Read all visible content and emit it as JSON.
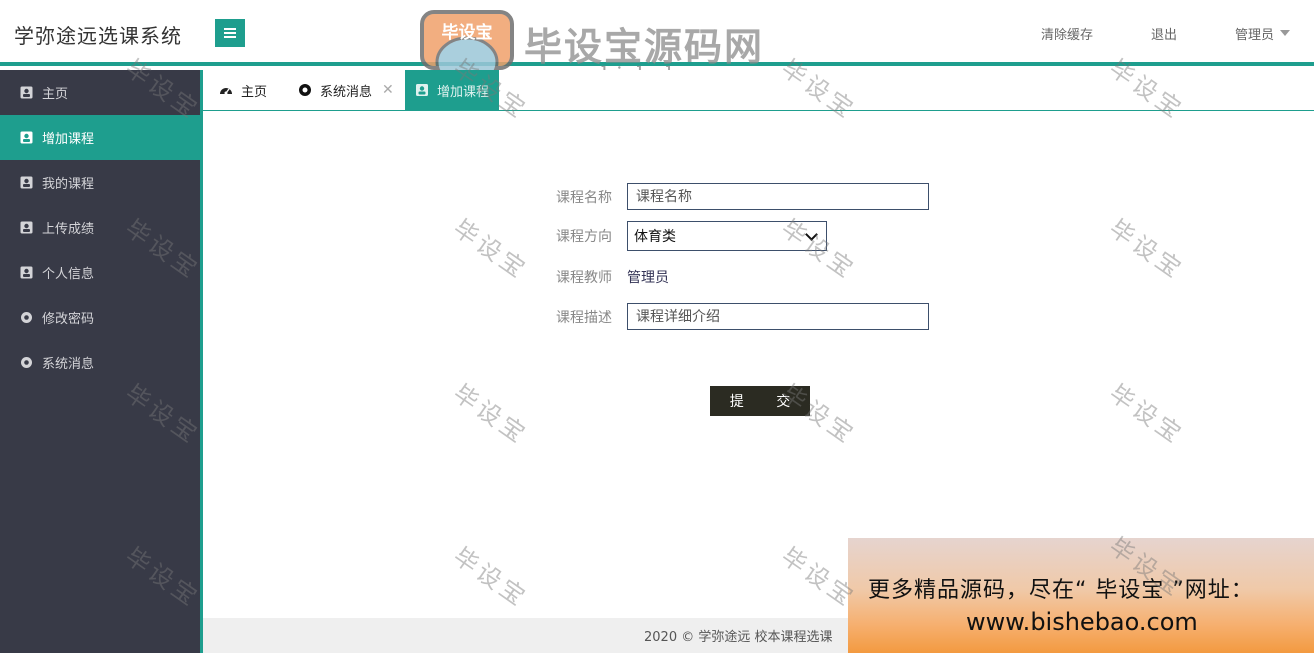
{
  "app": {
    "title": "学弥途远选课系统"
  },
  "header": {
    "clear_cache": "清除缓存",
    "logout": "退出",
    "user": "管理员"
  },
  "brand": {
    "name": "毕设宝源码网",
    "url": "www.bishebao.com",
    "logo_text": "毕设宝"
  },
  "sidebar": {
    "items": [
      {
        "label": "主页",
        "icon": "user-card-icon"
      },
      {
        "label": "增加课程",
        "icon": "user-card-icon",
        "active": true
      },
      {
        "label": "我的课程",
        "icon": "user-card-icon"
      },
      {
        "label": "上传成绩",
        "icon": "user-card-icon"
      },
      {
        "label": "个人信息",
        "icon": "user-card-icon"
      },
      {
        "label": "修改密码",
        "icon": "circle-icon"
      },
      {
        "label": "系统消息",
        "icon": "circle-icon"
      }
    ]
  },
  "tabs": [
    {
      "label": "主页",
      "icon": "dashboard-icon"
    },
    {
      "label": "系统消息",
      "icon": "circle-icon",
      "close": "✕"
    },
    {
      "label": "增加课程",
      "icon": "user-card-icon",
      "active": true
    }
  ],
  "form": {
    "name_label": "课程名称",
    "name_placeholder": "课程名称",
    "direction_label": "课程方向",
    "direction_value": "体育类",
    "teacher_label": "课程教师",
    "teacher_value": "管理员",
    "desc_label": "课程描述",
    "desc_placeholder": "课程详细介绍",
    "submit": "提 交"
  },
  "footer": {
    "text": "2020 ©  学弥途远  校本课程选课"
  },
  "ad": {
    "line1": "更多精品源码，尽在“ 毕设宝 ”网址：",
    "line2": "www.bishebao.com"
  },
  "watermark": "毕设宝",
  "colors": {
    "accent": "#1e9e8e",
    "sidebar": "#383a47",
    "button": "#2b2b22"
  }
}
